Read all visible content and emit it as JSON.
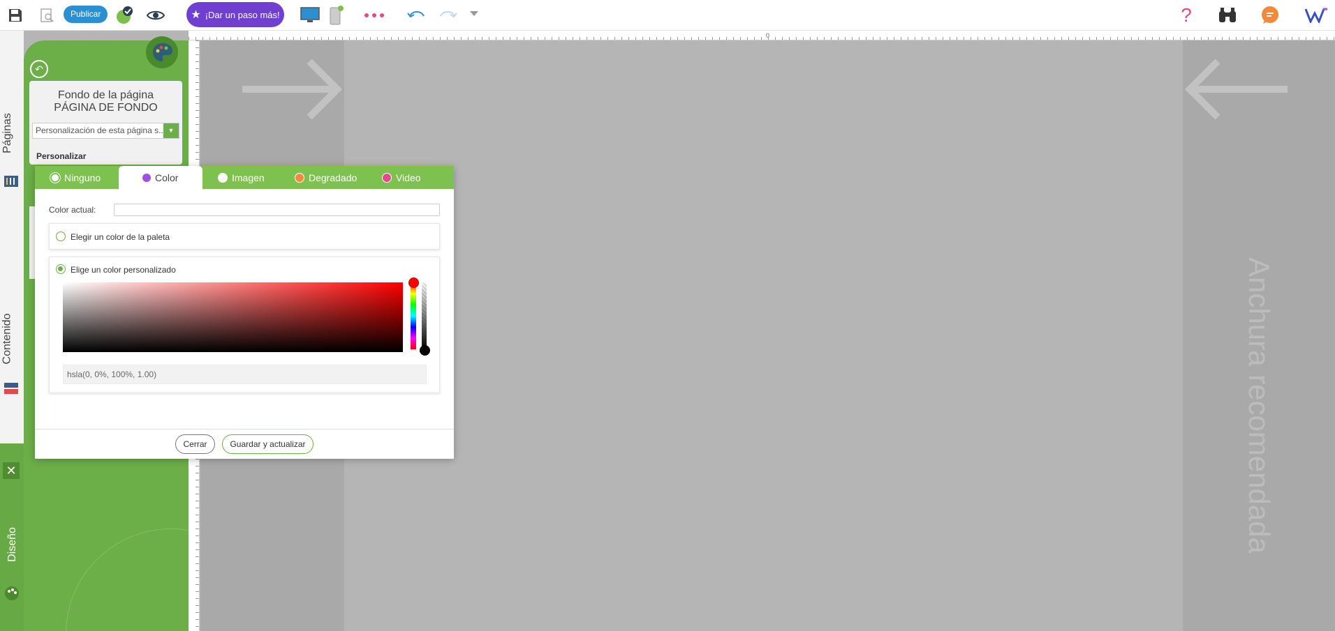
{
  "toolbar": {
    "publish_label": "Publicar",
    "upgrade_label": "¡Dar un paso más!",
    "icons": [
      "save-icon",
      "preview-page-icon",
      "checklist-icon",
      "eye-icon",
      "star-icon",
      "desktop-icon",
      "mobile-icon",
      "more-icon",
      "undo-icon",
      "redo-icon",
      "history-dropdown-icon",
      "help-icon",
      "binoculars-icon",
      "chat-icon",
      "logo-icon"
    ]
  },
  "ruler": {
    "zero_label": "0"
  },
  "canvas": {
    "recommended_width_label": "Anchura recomendada"
  },
  "side_tabs": {
    "pages": "Páginas",
    "content": "Contenido",
    "design": "Diseño"
  },
  "panel": {
    "title_line1": "Fondo de la página",
    "title_line2": "PÁGINA DE FONDO",
    "select_value": "Personalización de esta página s...",
    "subtitle": "Personalizar"
  },
  "dialog": {
    "tabs": [
      {
        "label": "Ninguno",
        "icon": "none-icon",
        "color": "#ffffff"
      },
      {
        "label": "Color",
        "icon": "color-dot-icon",
        "color": "#a24ee0"
      },
      {
        "label": "Imagen",
        "icon": "image-icon",
        "color": "#ffffff"
      },
      {
        "label": "Degradado",
        "icon": "gradient-icon",
        "color": "#f28a3c"
      },
      {
        "label": "Video",
        "icon": "video-icon",
        "color": "#e24a8b"
      }
    ],
    "active_tab": "Color",
    "current_color_label": "Color actual:",
    "current_color_value": "",
    "palette_option": "Elegir un color de la paleta",
    "custom_option": "Elige un color personalizado",
    "hsla_value": "hsla(0, 0%, 100%, 1.00)",
    "close_label": "Cerrar",
    "save_label": "Guardar y actualizar"
  },
  "colors": {
    "green": "#6cae47",
    "tab_green": "#7dc24e",
    "publish_blue": "#2b8fd4",
    "upgrade_purple": "#6f3fd1"
  }
}
